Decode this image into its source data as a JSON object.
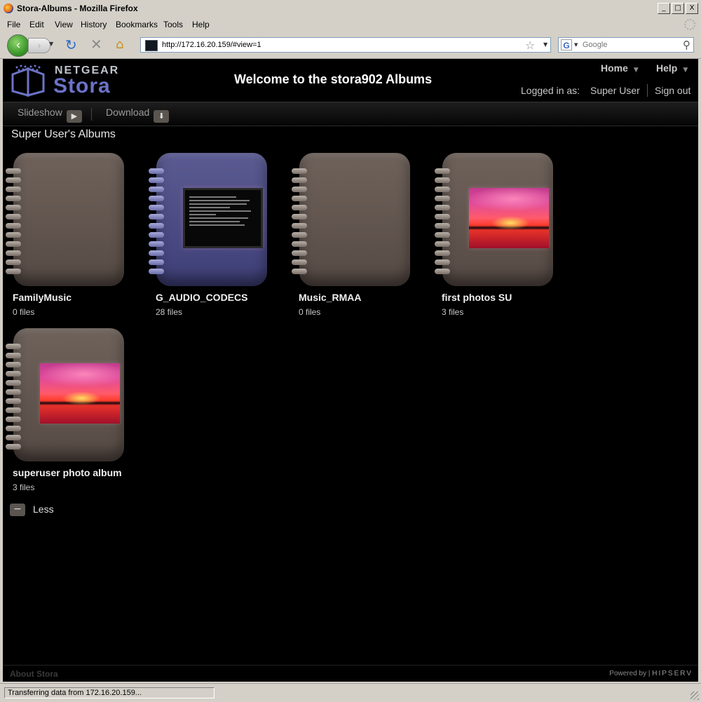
{
  "window": {
    "title": "Stora-Albums - Mozilla Firefox",
    "min": "_",
    "max": "□",
    "close": "X"
  },
  "menu": [
    "File",
    "Edit",
    "View",
    "History",
    "Bookmarks",
    "Tools",
    "Help"
  ],
  "nav": {
    "url": "http://172.16.20.159/#view=1",
    "search_placeholder": "Google",
    "back_glyph": "‹",
    "forward_glyph": "›",
    "reload_glyph": "↻",
    "stop_glyph": "✕",
    "home_glyph": "⌂",
    "star_glyph": "☆",
    "search_glyph": "⚲",
    "dropdown_glyph": "▼"
  },
  "site": {
    "brand": "NETGEAR",
    "product": "Stora",
    "title": "Welcome to the stora902 Albums",
    "home_link": "Home",
    "help_link": "Help",
    "logged_in_label": "Logged in as:",
    "user": "Super User",
    "sign_out": "Sign out",
    "caret": "▼"
  },
  "toolbar": {
    "slideshow": "Slideshow",
    "download": "Download",
    "slideshow_icon": "▶",
    "download_icon": "⬇"
  },
  "section_title": "Super User's Albums",
  "albums": [
    {
      "name": "FamilyMusic",
      "count": "0 files",
      "cover": "brown",
      "thumb": "none"
    },
    {
      "name": "G_AUDIO_CODECS",
      "count": "28 files",
      "cover": "blue",
      "thumb": "text-doc"
    },
    {
      "name": "Music_RMAA",
      "count": "0 files",
      "cover": "brown",
      "thumb": "none"
    },
    {
      "name": "first photos SU",
      "count": "3 files",
      "cover": "brown",
      "thumb": "sunset"
    },
    {
      "name": "superuser photo album",
      "count": "3 files",
      "cover": "brown",
      "thumb": "sunset"
    }
  ],
  "less": {
    "label": "Less",
    "icon": "−"
  },
  "footer": {
    "about": "About Stora",
    "powered_by": "Powered by |",
    "powered_brand": "HIPSERV"
  },
  "status": {
    "text": "Transferring data from 172.16.20.159..."
  },
  "colors": {
    "page_bg": "#000000",
    "album_brown": "#6e625b",
    "album_blue": "#5b5b92",
    "logo_blue": "#6c73c8",
    "chrome": "#d4d0c8"
  }
}
